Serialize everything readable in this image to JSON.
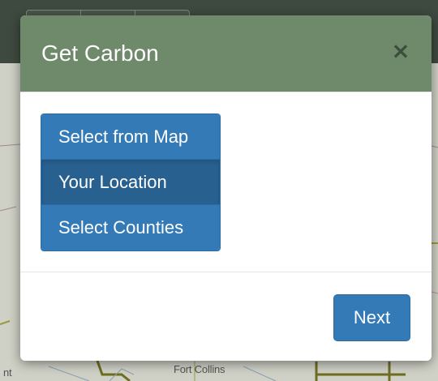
{
  "modal": {
    "title": "Get Carbon",
    "close_label": "×",
    "options": [
      {
        "label": "Select from Map",
        "active": false
      },
      {
        "label": "Your Location",
        "active": true
      },
      {
        "label": "Select Counties",
        "active": false
      }
    ],
    "next_label": "Next"
  },
  "map": {
    "labels": [
      "Fort Collins",
      "nt"
    ]
  },
  "colors": {
    "header_bg": "#6e8a6a",
    "primary": "#337ab7",
    "primary_active": "#286090",
    "topbar": "#3e4a3f"
  }
}
